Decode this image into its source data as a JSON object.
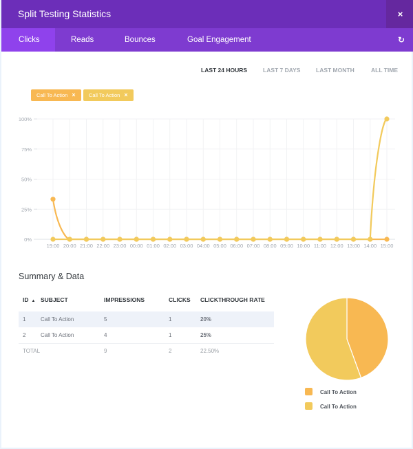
{
  "window": {
    "title": "Split Testing Statistics",
    "close_icon": "×"
  },
  "tabs": [
    {
      "label": "Clicks",
      "active": true
    },
    {
      "label": "Reads",
      "active": false
    },
    {
      "label": "Bounces",
      "active": false
    },
    {
      "label": "Goal Engagement",
      "active": false
    }
  ],
  "refresh_icon": "↻",
  "ranges": [
    {
      "label": "LAST 24 HOURS",
      "active": true
    },
    {
      "label": "LAST 7 DAYS",
      "active": false
    },
    {
      "label": "LAST MONTH",
      "active": false
    },
    {
      "label": "ALL TIME",
      "active": false
    }
  ],
  "filters": [
    {
      "label": "Call To Action",
      "color": "#f8b852",
      "remove_icon": "×"
    },
    {
      "label": "Call To Action",
      "color": "#f2ca5c",
      "remove_icon": "×"
    }
  ],
  "chart_data": [
    {
      "type": "line",
      "x": [
        "19:00",
        "20:00",
        "21:00",
        "22:00",
        "23:00",
        "00:00",
        "01:00",
        "02:00",
        "03:00",
        "04:00",
        "05:00",
        "06:00",
        "07:00",
        "08:00",
        "09:00",
        "10:00",
        "11:00",
        "12:00",
        "13:00",
        "14:00",
        "15:00"
      ],
      "yticks": [
        "0%",
        "25%",
        "50%",
        "75%",
        "100%"
      ],
      "ylim": [
        0,
        100
      ],
      "grid": true,
      "series": [
        {
          "name": "Call To Action",
          "color": "#f8b852",
          "values": [
            33.3,
            0,
            0,
            0,
            0,
            0,
            0,
            0,
            0,
            0,
            0,
            0,
            0,
            0,
            0,
            0,
            0,
            0,
            0,
            0,
            0
          ]
        },
        {
          "name": "Call To Action",
          "color": "#f2ca5c",
          "values": [
            0,
            0,
            0,
            0,
            0,
            0,
            0,
            0,
            0,
            0,
            0,
            0,
            0,
            0,
            0,
            0,
            0,
            0,
            0,
            0,
            100
          ]
        }
      ]
    },
    {
      "type": "pie",
      "labels": [
        "Call To Action",
        "Call To Action"
      ],
      "values": [
        20,
        25
      ],
      "colors": [
        "#f8b852",
        "#f2ca5c"
      ],
      "legend": "bottom"
    }
  ],
  "summary": {
    "title": "Summary & Data",
    "columns": [
      "ID",
      "SUBJECT",
      "IMPRESSIONS",
      "CLICKS",
      "CLICKTHROUGH RATE"
    ],
    "sort_icon": "▲",
    "rows": [
      {
        "id": "1",
        "subject": "Call To Action",
        "impressions": "5",
        "clicks": "1",
        "rate": "20%"
      },
      {
        "id": "2",
        "subject": "Call To Action",
        "impressions": "4",
        "clicks": "1",
        "rate": "25%"
      }
    ],
    "total": {
      "label": "TOTAL",
      "impressions": "9",
      "clicks": "2",
      "rate": "22.50%"
    }
  }
}
